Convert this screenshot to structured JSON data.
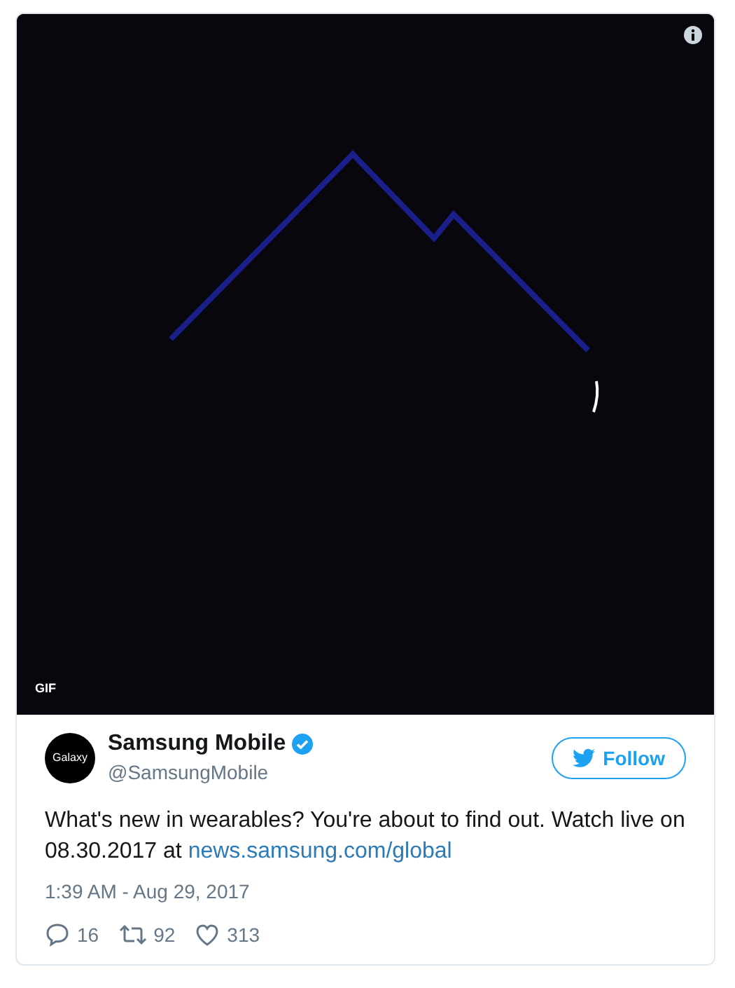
{
  "media": {
    "badge": "GIF"
  },
  "author": {
    "avatar_text": "Galaxy",
    "name": "Samsung Mobile",
    "verified": true,
    "handle": "@SamsungMobile"
  },
  "follow_button": {
    "label": "Follow"
  },
  "tweet": {
    "text": "What's new in wearables? You're about to find out. Watch live on 08.30.2017 at ",
    "link": "news.samsung.com/global"
  },
  "timestamp": "1:39 AM - Aug 29, 2017",
  "actions": [
    {
      "kind": "reply",
      "count": "16"
    },
    {
      "kind": "retweet",
      "count": "92"
    },
    {
      "kind": "like",
      "count": "313"
    }
  ]
}
